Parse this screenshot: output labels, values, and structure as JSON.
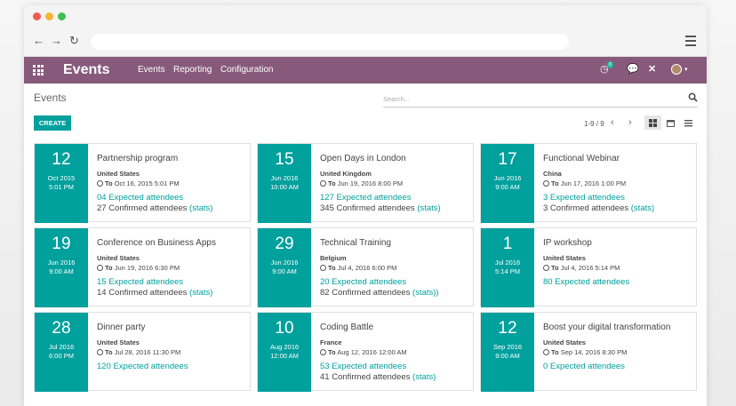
{
  "app": {
    "title": "Events",
    "menu": [
      "Events",
      "Reporting",
      "Configuration"
    ],
    "notification_count": "8",
    "accent_color": "#875a7b",
    "primary_color": "#00a09d"
  },
  "control": {
    "breadcrumb": "Events",
    "search_placeholder": "Search...",
    "create_label": "CREATE",
    "pager": "1-9 / 9"
  },
  "events": [
    {
      "day": "12",
      "month": "Oct 2015",
      "time": "5:01 PM",
      "name": "Partnership program",
      "country": "United States",
      "to_label": "To",
      "to_date": "Oct 16, 2015 5:01 PM",
      "expected": "04 Expected attendees",
      "confirmed_text": "27 Confirmed attendees",
      "stats": "(stats)"
    },
    {
      "day": "15",
      "month": "Jun 2016",
      "time": "10:00 AM",
      "name": "Open Days in London",
      "country": "United Kingdom",
      "to_label": "To",
      "to_date": "Jun 19, 2016 8:00 PM",
      "expected": "127 Expected attendees",
      "confirmed_text": "345 Confirmed attendees",
      "stats": "(stats)"
    },
    {
      "day": "17",
      "month": "Jun 2016",
      "time": "9:00 AM",
      "name": "Functional Webinar",
      "country": "China",
      "to_label": "To",
      "to_date": "Jun 17, 2016 1:00 PM",
      "expected": "3 Expected attendees",
      "confirmed_text": "3 Confirmed attendees",
      "stats": "(stats)"
    },
    {
      "day": "19",
      "month": "Jun 2016",
      "time": "9:00 AM",
      "name": "Conference on Business Apps",
      "country": "United States",
      "to_label": "To",
      "to_date": "Jun 19, 2016 6:30 PM",
      "expected": "15 Expected attendees",
      "confirmed_text": "14 Confirmed attendees",
      "stats": "(stats)"
    },
    {
      "day": "29",
      "month": "Jun 2016",
      "time": "9:00 AM",
      "name": "Technical Training",
      "country": "Belgium",
      "to_label": "To",
      "to_date": "Jul 4, 2016 6:00 PM",
      "expected": "20 Expected attendees",
      "confirmed_text": "82 Confirmed attendees",
      "stats": "(stats))"
    },
    {
      "day": "1",
      "month": "Jul 2016",
      "time": "5:14 PM",
      "name": "IP workshop",
      "country": "United States",
      "to_label": "To",
      "to_date": "Jul 4, 2016 5:14 PM",
      "expected": "80 Expected attendees",
      "confirmed_text": "",
      "stats": ""
    },
    {
      "day": "28",
      "month": "Jul 2016",
      "time": "6:00 PM",
      "name": "Dinner party",
      "country": "United States",
      "to_label": "To",
      "to_date": "Jul 28, 2016 11:30 PM",
      "expected": "120 Expected attendees",
      "confirmed_text": "",
      "stats": ""
    },
    {
      "day": "10",
      "month": "Aug 2016",
      "time": "12:00 AM",
      "name": "Coding Battle",
      "country": "France",
      "to_label": "To",
      "to_date": "Aug 12, 2016 12:00 AM",
      "expected": "53 Expected attendees",
      "confirmed_text": "41 Confirmed attendees",
      "stats": "(stats)"
    },
    {
      "day": "12",
      "month": "Sep 2016",
      "time": "9:00 AM",
      "name": "Boost your digital transformation",
      "country": "United States",
      "to_label": "To",
      "to_date": "Sep 14, 2016 8:30 PM",
      "expected": "0 Expected attendees",
      "confirmed_text": "",
      "stats": ""
    }
  ]
}
